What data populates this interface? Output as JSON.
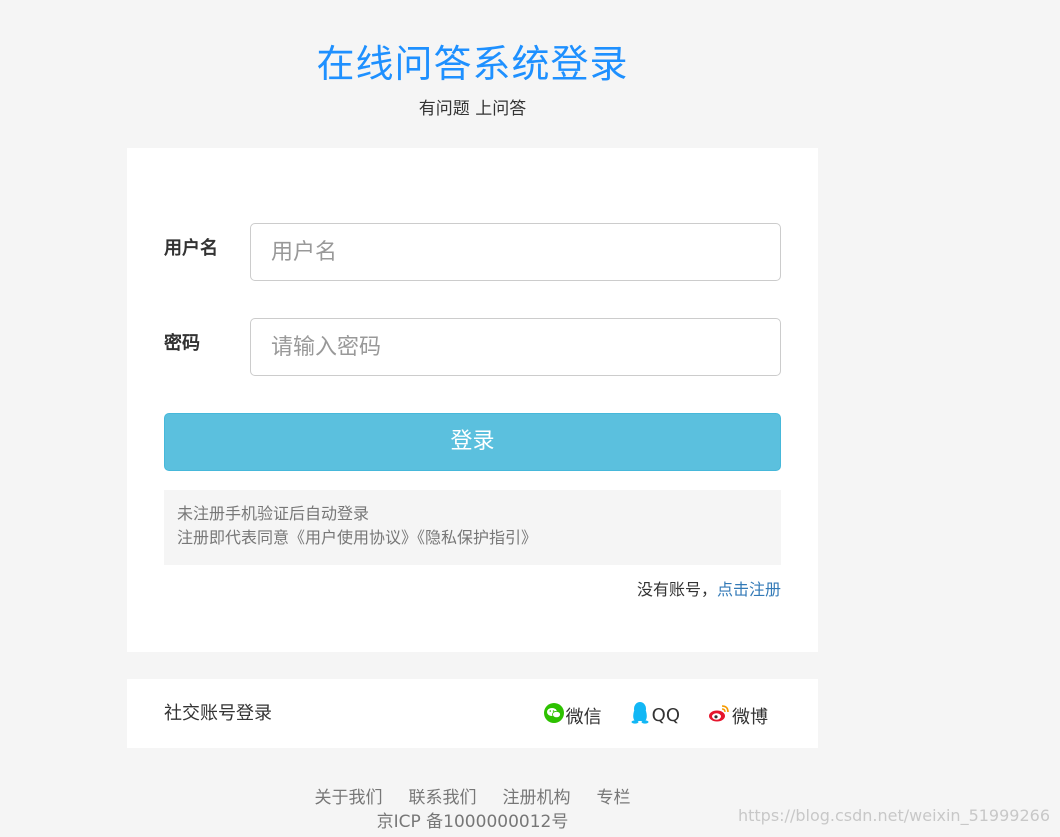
{
  "header": {
    "title": "在线问答系统登录",
    "subtitle": "有问题 上问答"
  },
  "login_form": {
    "username_label": "用户名",
    "username_placeholder": "用户名",
    "username_value": "",
    "password_label": "密码",
    "password_placeholder": "请输入密码",
    "password_value": "",
    "login_button": "登录",
    "notice_line1": "未注册手机验证后自动登录",
    "notice_line2": "注册即代表同意《用户使用协议》《隐私保护指引》",
    "no_account_text": "没有账号，",
    "register_link": "点击注册"
  },
  "social_login": {
    "label": "社交账号登录",
    "items": [
      {
        "label": "微信",
        "icon": "wechat-icon",
        "color": "#2dc100"
      },
      {
        "label": "QQ",
        "icon": "qq-icon",
        "color": "#12b7f5"
      },
      {
        "label": "微博",
        "icon": "weibo-icon",
        "color": "#e6162d"
      }
    ]
  },
  "footer": {
    "links": [
      "关于我们",
      "联系我们",
      "注册机构",
      "专栏"
    ],
    "icp": "京ICP 备1000000012号"
  },
  "watermark": "https://blog.csdn.net/weixin_51999266",
  "colors": {
    "accent": "#1e90ff",
    "button": "#5bc0de",
    "link": "#337ab7",
    "background": "#f5f5f5"
  }
}
